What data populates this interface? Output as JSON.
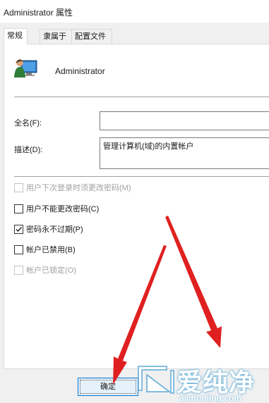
{
  "window": {
    "title": "Administrator 属性"
  },
  "tabs": [
    {
      "label": "常规",
      "active": true
    },
    {
      "label": "隶属于",
      "active": false
    },
    {
      "label": "配置文件",
      "active": false
    }
  ],
  "user": {
    "name": "Administrator",
    "icon": "user-monitor-icon"
  },
  "fields": {
    "full_name": {
      "label": "全名(F):",
      "value": ""
    },
    "description": {
      "label": "描述(D):",
      "value": "管理计算机(域)的内置帐户"
    }
  },
  "checkboxes": [
    {
      "label": "用户下次登录时须更改密码(M)",
      "checked": false,
      "disabled": true
    },
    {
      "label": "用户不能更改密码(C)",
      "checked": false,
      "disabled": false
    },
    {
      "label": "密码永不过期(P)",
      "checked": true,
      "disabled": false
    },
    {
      "label": "帐户已禁用(B)",
      "checked": false,
      "disabled": false
    },
    {
      "label": "帐户已锁定(O)",
      "checked": false,
      "disabled": true
    }
  ],
  "buttons": {
    "ok_label": "确定"
  },
  "watermark": {
    "cn": "爱纯净",
    "en": "aichunjing.com"
  },
  "colors": {
    "arrow": "#e02020",
    "accent": "#0078d7",
    "watermark_glow": "#5aa9d6"
  }
}
